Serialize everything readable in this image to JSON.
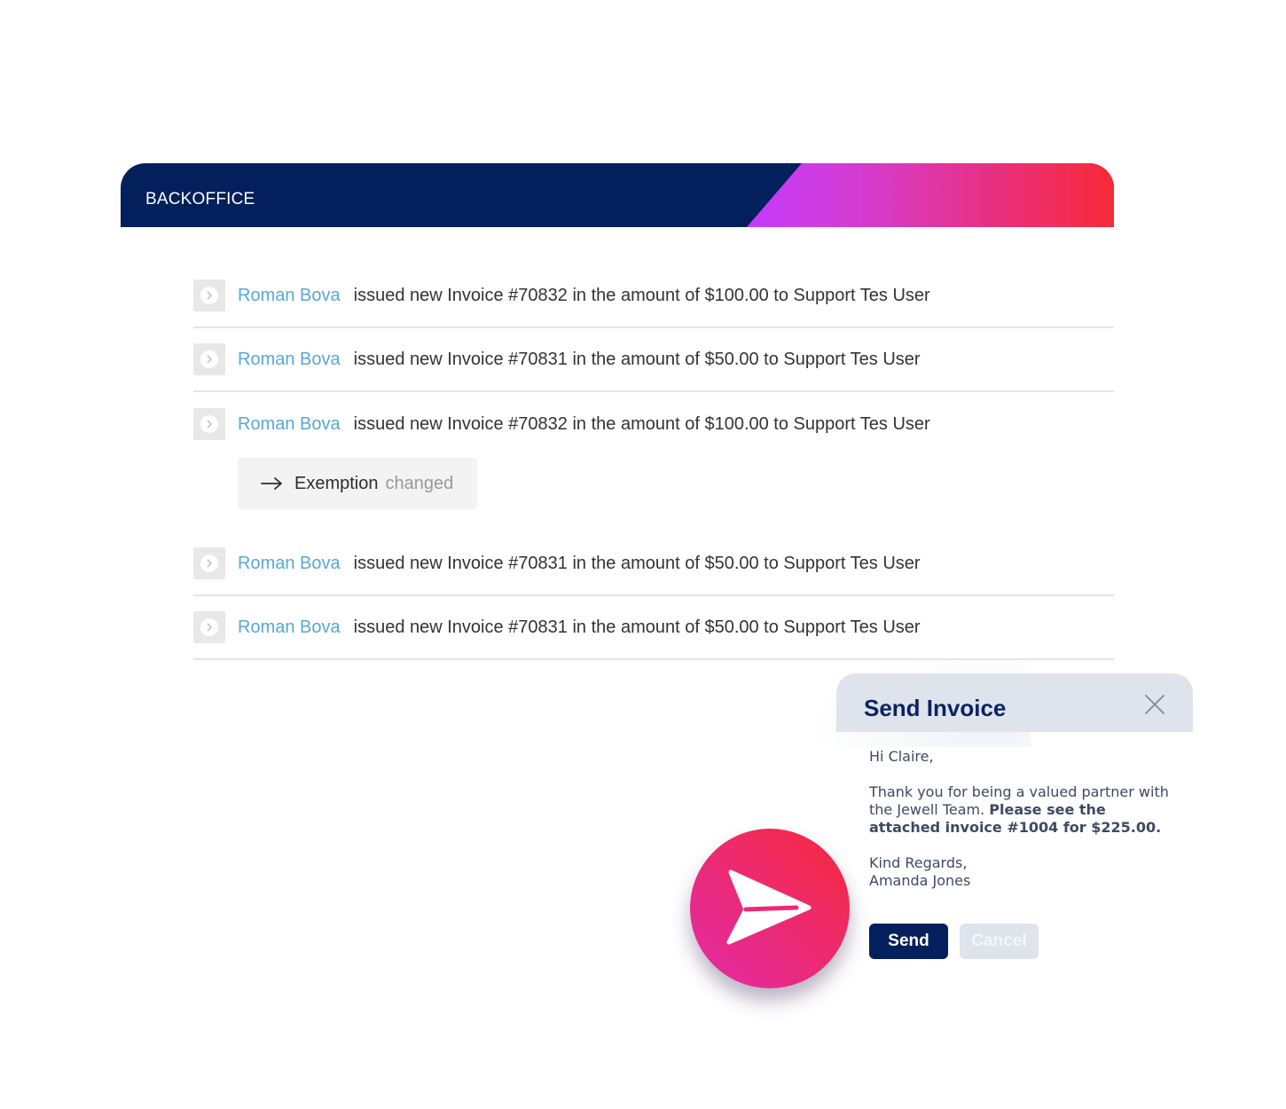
{
  "header": {
    "title": "BACKOFFICE",
    "colors": {
      "navy": "#04205c",
      "gradient_start": "#c43bff",
      "gradient_end": "#f72a36"
    }
  },
  "feed": {
    "items": [
      {
        "icon": "chevron-right-circle-icon",
        "user": "Roman Bova",
        "text": "issued new Invoice #70832 in the amount of $100.00 to Support Tes User"
      },
      {
        "icon": "chevron-right-circle-icon",
        "user": "Roman Bova",
        "text": "issued new Invoice #70831 in the amount of $50.00 to Support Tes User"
      },
      {
        "icon": "chevron-right-circle-icon",
        "user": "Roman Bova",
        "text": "issued new Invoice #70832 in the amount of $100.00 to Support Tes User",
        "detail": {
          "icon": "arrow-right-icon",
          "label": "Exemption",
          "status": "changed"
        }
      },
      {
        "icon": "chevron-right-circle-icon",
        "user": "Roman Bova",
        "text": "issued new Invoice #70831 in the amount of $50.00 to Support Tes User"
      },
      {
        "icon": "chevron-right-circle-icon",
        "user": "Roman Bova",
        "text": "issued new Invoice #70831 in the amount of $50.00 to Support Tes User"
      }
    ]
  },
  "dialog": {
    "title": "Send Invoice",
    "close_icon": "close-icon",
    "greeting": "Hi Claire,",
    "message_plain": "Thank you for being a valued partner with the Jewell Team.",
    "message_bold": "Please see the attached invoice #1004 for $225.00.",
    "closing": "Kind Regards,",
    "signature": "Amanda Jones",
    "send_label": "Send",
    "cancel_label": "Cancel"
  },
  "badge": {
    "icon": "send-icon"
  }
}
